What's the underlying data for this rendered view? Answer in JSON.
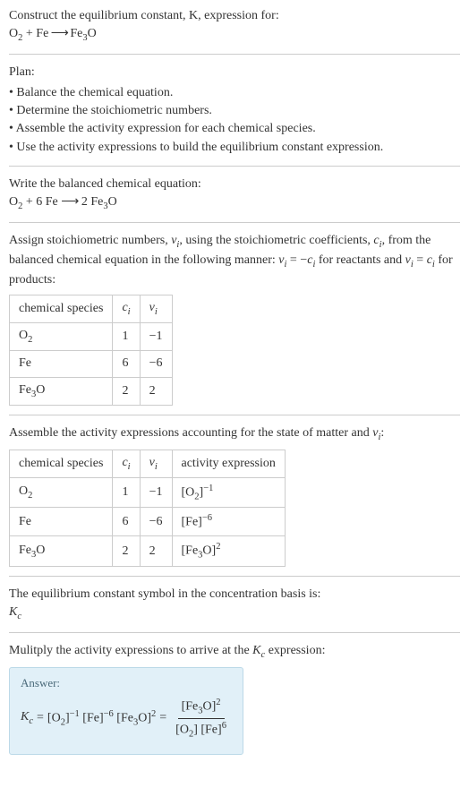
{
  "s1": {
    "prompt_line1": "Construct the equilibrium constant, K, expression for:",
    "eq_lhs_o2": "O",
    "eq_lhs_o2_sub": "2",
    "eq_plus1": " + ",
    "eq_lhs_fe": "Fe",
    "eq_arrow": " ⟶ ",
    "eq_rhs_fe3o_a": "Fe",
    "eq_rhs_fe3o_sub": "3",
    "eq_rhs_fe3o_b": "O"
  },
  "s2": {
    "heading": "Plan:",
    "b1": "Balance the chemical equation.",
    "b2": "Determine the stoichiometric numbers.",
    "b3": "Assemble the activity expression for each chemical species.",
    "b4": "Use the activity expressions to build the equilibrium constant expression."
  },
  "s3": {
    "heading": "Write the balanced chemical equation:",
    "o2a": "O",
    "o2sub": "2",
    "plus": " + 6 Fe ",
    "arrow": "⟶",
    "rhs": " 2 Fe",
    "rhs_sub": "3",
    "rhs_o": "O"
  },
  "s4": {
    "para_a": "Assign stoichiometric numbers, ",
    "nu": "ν",
    "i1": "i",
    "para_b": ", using the stoichiometric coefficients, ",
    "c": "c",
    "i2": "i",
    "para_c": ", from the balanced chemical equation in the following manner: ",
    "nu2": "ν",
    "i3": "i",
    "eqm": " = −",
    "c2": "c",
    "i4": "i",
    "para_d": " for reactants and ",
    "nu3": "ν",
    "i5": "i",
    "eqp": " = ",
    "c3": "c",
    "i6": "i",
    "para_e": " for products:",
    "h_species": "chemical species",
    "h_ci_c": "c",
    "h_ci_i": "i",
    "h_vi_v": "ν",
    "h_vi_i": "i",
    "r1_sp_a": "O",
    "r1_sp_sub": "2",
    "r1_c": "1",
    "r1_v": "−1",
    "r2_sp": "Fe",
    "r2_c": "6",
    "r2_v": "−6",
    "r3_sp_a": "Fe",
    "r3_sp_sub": "3",
    "r3_sp_b": "O",
    "r3_c": "2",
    "r3_v": "2"
  },
  "s5": {
    "para_a": "Assemble the activity expressions accounting for the state of matter and ",
    "nu": "ν",
    "i": "i",
    "colon": ":",
    "h_species": "chemical species",
    "h_ci_c": "c",
    "h_ci_i": "i",
    "h_vi_v": "ν",
    "h_vi_i": "i",
    "h_act": "activity expression",
    "r1_sp_a": "O",
    "r1_sp_sub": "2",
    "r1_c": "1",
    "r1_v": "−1",
    "r1_act_a": "[O",
    "r1_act_sub": "2",
    "r1_act_b": "]",
    "r1_act_sup": "−1",
    "r2_sp": "Fe",
    "r2_c": "6",
    "r2_v": "−6",
    "r2_act_a": "[Fe]",
    "r2_act_sup": "−6",
    "r3_sp_a": "Fe",
    "r3_sp_sub": "3",
    "r3_sp_b": "O",
    "r3_c": "2",
    "r3_v": "2",
    "r3_act_a": "[Fe",
    "r3_act_sub": "3",
    "r3_act_b": "O]",
    "r3_act_sup": "2"
  },
  "s6": {
    "line1": "The equilibrium constant symbol in the concentration basis is:",
    "k": "K",
    "c": "c"
  },
  "s7": {
    "para_a": "Mulitply the activity expressions to arrive at the ",
    "k": "K",
    "c": "c",
    "para_b": " expression:",
    "answer": "Answer:",
    "lhs_k": "K",
    "lhs_c": "c",
    "eq": " = ",
    "t1_a": "[O",
    "t1_sub": "2",
    "t1_b": "]",
    "t1_sup": "−1",
    "t2_a": " [Fe]",
    "t2_sup": "−6",
    "t3_a": " [Fe",
    "t3_sub": "3",
    "t3_b": "O]",
    "t3_sup": "2",
    "eq2": " = ",
    "num_a": "[Fe",
    "num_sub": "3",
    "num_b": "O]",
    "num_sup": "2",
    "den_a": "[O",
    "den_sub": "2",
    "den_b": "] [Fe]",
    "den_sup": "6"
  }
}
